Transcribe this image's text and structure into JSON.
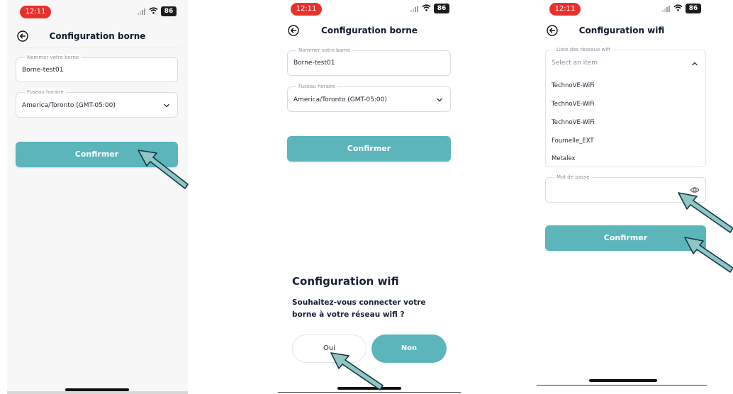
{
  "status": {
    "time": "12:11",
    "battery": "86"
  },
  "screen1": {
    "title": "Configuration borne",
    "name_label": "Nommer votre borne",
    "name_value": "Borne-test01",
    "timezone_label": "Fuseau horaire",
    "timezone_value": "America/Toronto (GMT-05:00)",
    "confirm_label": "Confirmer"
  },
  "screen2": {
    "title": "Configuration borne",
    "name_label": "Nommer votre borne",
    "name_value": "Borne-test01",
    "timezone_label": "Fuseau horaire",
    "timezone_value": "America/Toronto (GMT-05:00)",
    "confirm_label": "Confirmer",
    "dialog_title": "Configuration wifi",
    "dialog_message": "Souhaitez-vous connecter votre borne à votre réseau wifi ?",
    "yes_label": "Oui",
    "no_label": "Non"
  },
  "screen3": {
    "title": "Configuration wifi",
    "networks_label": "Liste des réseaux wifi",
    "networks_placeholder": "Select an item",
    "networks": [
      "TechnoVE-WiFi",
      "TechnoVE-WiFi",
      "TechnoVE-WiFi",
      "Fournelle_EXT",
      "Metalex"
    ],
    "password_label": "Mot de passe",
    "confirm_label": "Confirmer"
  },
  "colors": {
    "accent": "#5bb5bb",
    "time_pill": "#e8302d",
    "arrow_fill": "#8fc5c3",
    "arrow_stroke": "#123a46"
  },
  "icons": [
    "back-icon",
    "chevron-down-icon",
    "chevron-up-icon",
    "eye-icon",
    "wifi-icon",
    "signal-icon",
    "battery-icon",
    "arrow-pointer-icon"
  ]
}
